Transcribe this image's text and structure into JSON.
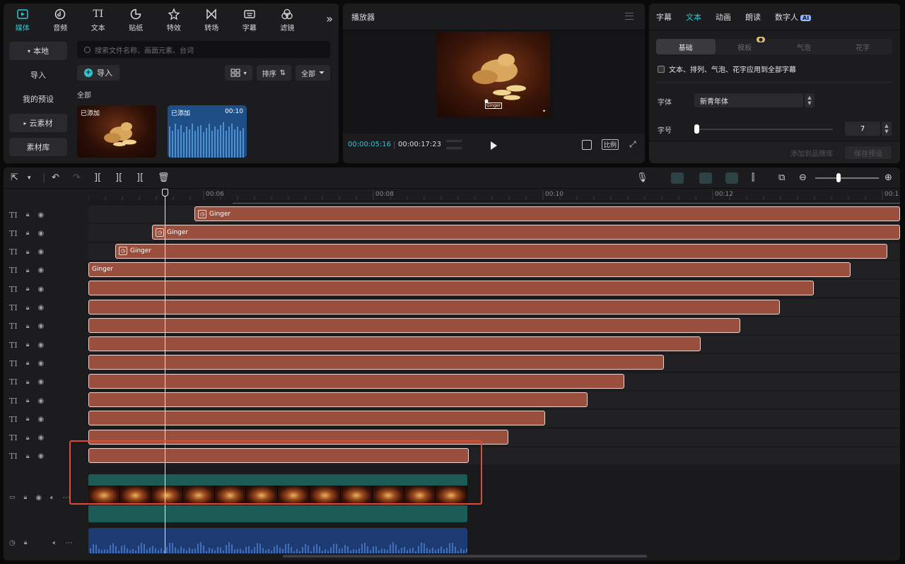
{
  "media": {
    "nav": [
      {
        "label": "媒体",
        "icon": "media-icon",
        "active": true
      },
      {
        "label": "音频",
        "icon": "audio-icon"
      },
      {
        "label": "文本",
        "icon": "text-icon",
        "glyph": "TI"
      },
      {
        "label": "贴纸",
        "icon": "sticker-icon"
      },
      {
        "label": "特效",
        "icon": "effects-icon"
      },
      {
        "label": "转场",
        "icon": "transition-icon"
      },
      {
        "label": "字幕",
        "icon": "caption-icon"
      },
      {
        "label": "滤镜",
        "icon": "filter-icon"
      }
    ],
    "sidebar": [
      "本地",
      "导入",
      "我的预设",
      "云素材",
      "素材库"
    ],
    "search_placeholder": "搜索文件名称、画面元素、台词",
    "import_label": "导入",
    "sort_label": "排序",
    "filter_label": "全部",
    "section_label": "全部",
    "thumbs": [
      {
        "tag": "已添加",
        "duration": ""
      },
      {
        "tag": "已添加",
        "duration": "00:10"
      }
    ]
  },
  "player": {
    "title": "播放器",
    "current_time": "00:00:05:16",
    "total_time": "00:00:17:23",
    "ratio_label": "比例",
    "video_caption": "Ginger"
  },
  "props": {
    "tabs": [
      {
        "label": "字幕"
      },
      {
        "label": "文本",
        "active": true
      },
      {
        "label": "动画"
      },
      {
        "label": "朗读"
      },
      {
        "label": "数字人",
        "badge": "AI"
      }
    ],
    "subtabs": [
      "基础",
      "模板",
      "气泡",
      "花字"
    ],
    "apply_all": "文本、排列、气泡、花字应用到全部字幕",
    "font_label": "字体",
    "font_value": "新青年体",
    "size_label": "字号",
    "size_value": "7",
    "size_fraction": 0.0,
    "add_brand": "添加到品牌库",
    "save_preset": "保存预设"
  },
  "timeline": {
    "ruler": [
      "00:06",
      "00:08",
      "00:10",
      "00:12",
      "00:1"
    ],
    "text_clips": [
      {
        "label": "Ginger",
        "has_icon": true
      },
      {
        "label": "Ginger",
        "has_icon": true
      },
      {
        "label": "Ginger",
        "has_icon": true
      },
      {
        "label": "Ginger",
        "has_icon": false
      },
      {
        "label": ""
      },
      {
        "label": ""
      },
      {
        "label": ""
      },
      {
        "label": ""
      },
      {
        "label": ""
      },
      {
        "label": ""
      },
      {
        "label": ""
      },
      {
        "label": ""
      },
      {
        "label": ""
      },
      {
        "label": ""
      }
    ],
    "colors": {
      "accent": "#2ec6d3",
      "clip": "#9a4e3d",
      "video_lane": "#1c5c56",
      "audio_lane": "#1d3b72",
      "highlight": "#e04a36"
    }
  }
}
